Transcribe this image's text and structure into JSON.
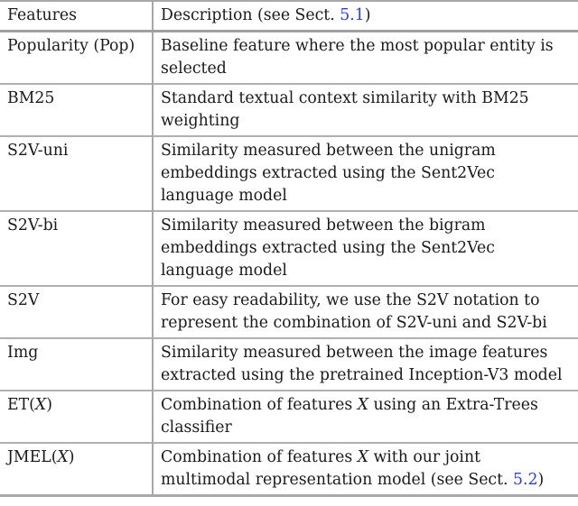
{
  "table": {
    "headers": {
      "feature": "Features",
      "description_prefix": "Description (see Sect. ",
      "description_ref": "5.1",
      "description_suffix": ")"
    },
    "rows": [
      {
        "feature": "Popularity (Pop)",
        "description": "Baseline feature where the most popular entity is selected"
      },
      {
        "feature": "BM25",
        "description": "Standard textual context similarity with BM25 weighting"
      },
      {
        "feature": "S2V-uni",
        "description": "Similarity measured between the unigram embeddings extracted using the Sent2Vec language model"
      },
      {
        "feature": "S2V-bi",
        "description": "Similarity measured between the bigram embeddings extracted using the Sent2Vec language model"
      },
      {
        "feature": "S2V",
        "description": "For easy readability, we use the S2V notation to represent the combination of S2V-uni and S2V-bi"
      },
      {
        "feature": "Img",
        "description": "Similarity measured between the image features extracted using the pretrained Inception-V3 model"
      },
      {
        "feature_prefix": "ET(",
        "feature_var": "X",
        "feature_suffix": ")",
        "description_prefix": "Combination of features ",
        "description_var": "X",
        "description_suffix": " using an Extra-Trees classifier"
      },
      {
        "feature_prefix": "JMEL(",
        "feature_var": "X",
        "feature_suffix": ")",
        "description_prefix": "Combination of features ",
        "description_var": "X",
        "description_mid": " with our joint multimodal representation model (see Sect. ",
        "description_ref": "5.2",
        "description_suffix": ")"
      }
    ]
  },
  "colors": {
    "reference_link": "#2a3fd6",
    "text": "#1a1a1a",
    "rule": "#a8a8a8"
  }
}
